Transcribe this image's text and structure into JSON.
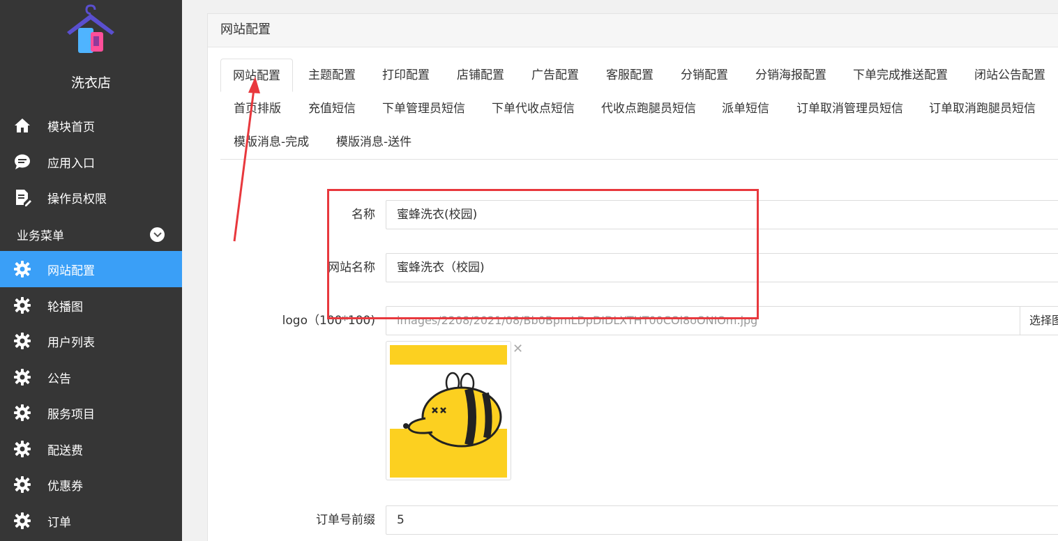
{
  "sidebar": {
    "store_name": "洗衣店",
    "nav": [
      {
        "label": "模块首页",
        "icon": "home-icon"
      },
      {
        "label": "应用入口",
        "icon": "chat-icon"
      },
      {
        "label": "操作员权限",
        "icon": "document-edit-icon"
      }
    ],
    "group_label": "业务菜单",
    "menu": [
      {
        "label": "网站配置",
        "icon": "gear-icon",
        "active": true
      },
      {
        "label": "轮播图",
        "icon": "gear-icon"
      },
      {
        "label": "用户列表",
        "icon": "gear-icon"
      },
      {
        "label": "公告",
        "icon": "gear-icon"
      },
      {
        "label": "服务项目",
        "icon": "gear-icon"
      },
      {
        "label": "配送费",
        "icon": "gear-icon"
      },
      {
        "label": "优惠券",
        "icon": "gear-icon"
      },
      {
        "label": "订单",
        "icon": "gear-icon"
      }
    ]
  },
  "panel": {
    "title": "网站配置",
    "tabs": [
      "网站配置",
      "主题配置",
      "打印配置",
      "店铺配置",
      "广告配置",
      "客服配置",
      "分销配置",
      "分销海报配置",
      "下单完成推送配置",
      "闭站公告配置",
      "首页排版",
      "充值短信",
      "下单管理员短信",
      "下单代收点短信",
      "代收点跑腿员短信",
      "派单短信",
      "订单取消管理员短信",
      "订单取消跑腿员短信",
      "模版消息-完成",
      "模版消息-送件"
    ]
  },
  "form": {
    "name_label": "名称",
    "name_value": "蜜蜂洗衣(校园)",
    "site_name_label": "网站名称",
    "site_name_value": "蜜蜂洗衣（校园)",
    "logo_label": "logo（100*100)",
    "logo_path": "images/2208/2021/08/Bb0BpmLDpDIDLXTHT00COl8oONIOm.jpg",
    "pick_button": "选择图片",
    "order_prefix_label": "订单号前缀",
    "order_prefix_value": "5"
  },
  "colors": {
    "sidebar_bg": "#363636",
    "active_blue": "#3a9ff7",
    "annotation_red": "#e8383d",
    "bee_yellow": "#fcd020"
  }
}
